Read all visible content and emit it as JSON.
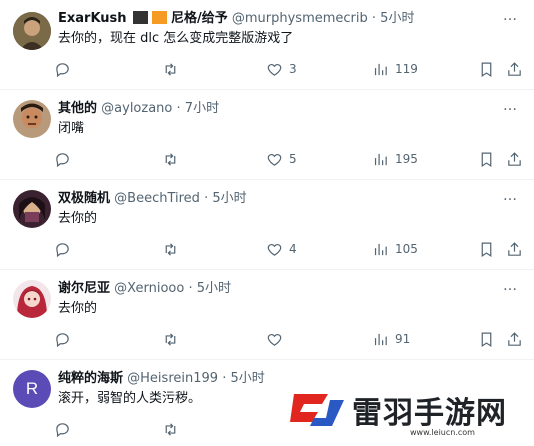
{
  "tweets": [
    {
      "name": "ExarKush",
      "handle": "@murphysmemecrib",
      "time": "5小时",
      "text": "去你的，现在 dlc 怎么变成完整版游戏了",
      "reply": "",
      "retweet": "",
      "likes": "3",
      "views": "119",
      "flags_text": "尼格/给予"
    },
    {
      "name": "其他的",
      "handle": "@aylozano",
      "time": "7小时",
      "text": "闭嘴",
      "reply": "",
      "retweet": "",
      "likes": "5",
      "views": "195"
    },
    {
      "name": "双极随机",
      "handle": "@BeechTired",
      "time": "5小时",
      "text": "去你的",
      "reply": "",
      "retweet": "",
      "likes": "4",
      "views": "105"
    },
    {
      "name": "谢尔尼亚",
      "handle": "@Xerniooo",
      "time": "5小时",
      "text": "去你的",
      "reply": "",
      "retweet": "",
      "likes": "",
      "views": "91"
    },
    {
      "name": "纯粹的海斯",
      "handle": "@Heisrein199",
      "time": "5小时",
      "text": "滚开，弱智的人类污秽。",
      "avatar_letter": "R",
      "likes": "",
      "views": ""
    }
  ],
  "separator": "·",
  "more_icon": "…",
  "watermark": {
    "text": "雷羽手游网",
    "url": "www.leiucn.com"
  },
  "colors": {
    "text_primary": "#0f1419",
    "text_secondary": "#536471",
    "border": "#eff3f4",
    "avatar_r": "#5b4bb7",
    "watermark_red": "#e0261f",
    "watermark_blue": "#2b59c3"
  }
}
